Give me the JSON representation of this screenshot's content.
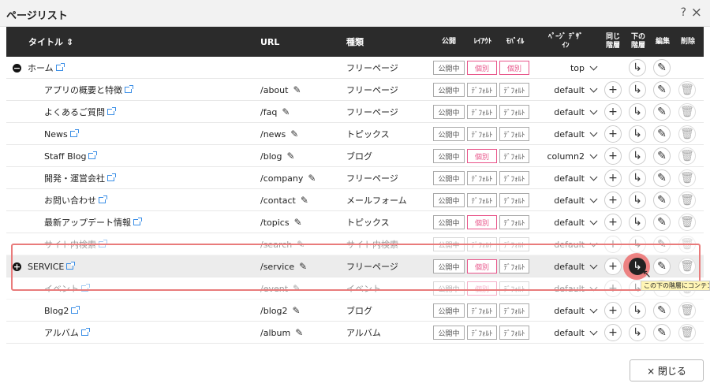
{
  "dialog": {
    "title": "ページリスト",
    "help": "?",
    "close_icon": "×"
  },
  "columns": {
    "title": "タイトル ⇕",
    "url": "URL",
    "type": "種類",
    "public": "公開",
    "layout": "ﾚｲｱｳﾄ",
    "mobile": "ﾓﾊﾞｲﾙ",
    "design": "ﾍﾟｰｼﾞ ﾃﾞｻﾞｲﾝ",
    "same_level": "同じ 階層",
    "lower_level": "下の 階層",
    "edit": "編集",
    "delete": "削除"
  },
  "rows": [
    {
      "title": "ホーム",
      "url": "",
      "type": "フリーページ",
      "public": "公開中",
      "layout": "個別",
      "mobile": "個別",
      "design": "top"
    },
    {
      "title": "アプリの概要と特徴",
      "url": "/about",
      "type": "フリーページ",
      "public": "公開中",
      "layout": "ﾃﾞﾌｫﾙﾄ",
      "mobile": "ﾃﾞﾌｫﾙﾄ",
      "design": "default"
    },
    {
      "title": "よくあるご質問",
      "url": "/faq",
      "type": "フリーページ",
      "public": "公開中",
      "layout": "ﾃﾞﾌｫﾙﾄ",
      "mobile": "ﾃﾞﾌｫﾙﾄ",
      "design": "default"
    },
    {
      "title": "News",
      "url": "/news",
      "type": "トピックス",
      "public": "公開中",
      "layout": "ﾃﾞﾌｫﾙﾄ",
      "mobile": "ﾃﾞﾌｫﾙﾄ",
      "design": "default"
    },
    {
      "title": "Staff Blog",
      "url": "/blog",
      "type": "ブログ",
      "public": "公開中",
      "layout": "個別",
      "mobile": "ﾃﾞﾌｫﾙﾄ",
      "design": "column2"
    },
    {
      "title": "開発・運営会社",
      "url": "/company",
      "type": "フリーページ",
      "public": "公開中",
      "layout": "ﾃﾞﾌｫﾙﾄ",
      "mobile": "ﾃﾞﾌｫﾙﾄ",
      "design": "default"
    },
    {
      "title": "お問い合わせ",
      "url": "/contact",
      "type": "メールフォーム",
      "public": "公開中",
      "layout": "ﾃﾞﾌｫﾙﾄ",
      "mobile": "ﾃﾞﾌｫﾙﾄ",
      "design": "default"
    },
    {
      "title": "最新アップデート情報",
      "url": "/topics",
      "type": "トピックス",
      "public": "公開中",
      "layout": "個別",
      "mobile": "ﾃﾞﾌｫﾙﾄ",
      "design": "default"
    },
    {
      "title": "サイト内検索",
      "url": "/search",
      "type": "サイト内検索",
      "public": "公開中",
      "layout": "ﾃﾞﾌｫﾙﾄ",
      "mobile": "ﾃﾞﾌｫﾙﾄ",
      "design": "default"
    },
    {
      "title": "SERVICE",
      "url": "/service",
      "type": "フリーページ",
      "public": "公開中",
      "layout": "個別",
      "mobile": "ﾃﾞﾌｫﾙﾄ",
      "design": "default"
    },
    {
      "title": "イベント",
      "url": "/event",
      "type": "イベント",
      "public": "公開中",
      "layout": "個別",
      "mobile": "ﾃﾞﾌｫﾙﾄ",
      "design": "default"
    },
    {
      "title": "Blog2",
      "url": "/blog2",
      "type": "ブログ",
      "public": "公開中",
      "layout": "ﾃﾞﾌｫﾙﾄ",
      "mobile": "ﾃﾞﾌｫﾙﾄ",
      "design": "default"
    },
    {
      "title": "アルバム",
      "url": "/album",
      "type": "アルバム",
      "public": "公開中",
      "layout": "ﾃﾞﾌｫﾙﾄ",
      "mobile": "ﾃﾞﾌｫﾙﾄ",
      "design": "default"
    }
  ],
  "tooltip": "この下の階層にコンテンツ",
  "footer": {
    "close_label": "× 閉じる"
  },
  "colors": {
    "header_bg": "#2b2b2b",
    "pink": "#e8558a",
    "highlight": "#e97b7b",
    "link_icon": "#3a8ee6"
  },
  "icons": {
    "collapse": "minus-circle-icon",
    "expand": "plus-circle-icon",
    "add_same": "plus-icon",
    "add_child": "add-child-icon",
    "edit": "pencil-icon",
    "delete": "trash-icon"
  }
}
